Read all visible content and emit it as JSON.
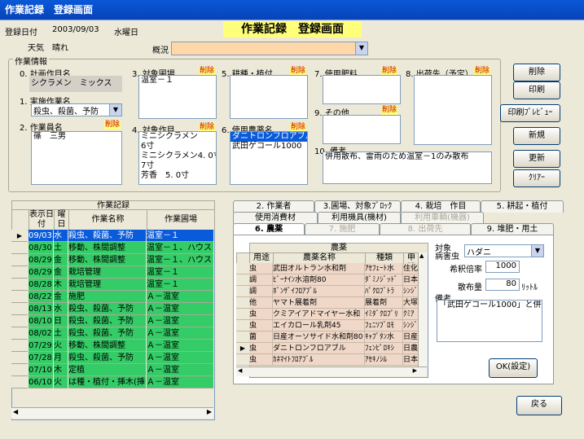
{
  "window_title": "作業記録　登録画面",
  "page_title": "作業記録　登録画面",
  "header": {
    "date_label": "登録日付",
    "date_value": "2003/09/03",
    "weekday": "水曜日",
    "weather_label": "天気",
    "weather_value": "晴れ",
    "condition_label": "概況",
    "condition_value": ""
  },
  "work_info": {
    "group_label": "作業情報",
    "plan_label": "0. 計画作目名",
    "plan_value": "シクラメン　ミックス",
    "method_label": "1. 実施作業名",
    "method_value": "殺虫、殺菌、予防",
    "worker_label": "2. 作業員名",
    "worker_value": "篠　三男",
    "field_label": "3. 対象圃場",
    "field_value": "温室－１",
    "crop_label": "4. 対象作目",
    "crop_lines": [
      "ミニシクラメン",
      "6寸",
      "ミニシクラメン4. 0寸",
      "7寸",
      "芳香　5. 0寸"
    ],
    "variety_label": "5. 耕種・植付",
    "pesticide_label": "6. 使用農薬名",
    "pesticide_lines": [
      "ダニトロンフロアブル",
      "武田ゲコール1000"
    ],
    "fertilizer_label": "7. 使用肥料",
    "other_label": "9. その他",
    "shipping_label": "8. 出荷先（予定）",
    "remarks_label": "10. 備考",
    "remarks_value": "併用散布、雷雨のため温室－1のみ散布",
    "delete_tag": "削除"
  },
  "buttons": {
    "delete": "削除",
    "print": "印刷",
    "preview": "印刷ﾌﾟﾚﾋﾞｭｰ",
    "new": "新規",
    "update": "更新",
    "clear": "ｸﾘｱｰ",
    "ok": "OK(設定)",
    "back": "戻る"
  },
  "records": {
    "title": "作業記録",
    "col_date": "表示日付",
    "col_weekday": "曜日",
    "col_name": "作業名称",
    "col_field": "作業圃場",
    "rows": [
      {
        "date": "09/03",
        "wd": "水",
        "name": "殺虫、殺菌、予防",
        "field": "温室－１"
      },
      {
        "date": "08/30",
        "wd": "土",
        "name": "移動、株間調整",
        "field": "温室－１、ハウス"
      },
      {
        "date": "08/29",
        "wd": "金",
        "name": "移動、株間調整",
        "field": "温室－１、ハウス"
      },
      {
        "date": "08/29",
        "wd": "金",
        "name": "栽培管理",
        "field": "温室－１"
      },
      {
        "date": "08/28",
        "wd": "木",
        "name": "栽培管理",
        "field": "温室－１"
      },
      {
        "date": "08/22",
        "wd": "金",
        "name": "施肥",
        "field": "Ａ－温室"
      },
      {
        "date": "08/13",
        "wd": "水",
        "name": "殺虫、殺菌、予防",
        "field": "Ａ－温室"
      },
      {
        "date": "08/10",
        "wd": "日",
        "name": "殺虫、殺菌、予防",
        "field": "Ａ－温室"
      },
      {
        "date": "08/02",
        "wd": "土",
        "name": "殺虫、殺菌、予防",
        "field": "Ａ－温室"
      },
      {
        "date": "07/29",
        "wd": "火",
        "name": "移動、株間調整",
        "field": "Ａ－温室"
      },
      {
        "date": "07/28",
        "wd": "月",
        "name": "殺虫、殺菌、予防",
        "field": "Ａ－温室"
      },
      {
        "date": "07/10",
        "wd": "木",
        "name": "定植",
        "field": "Ａ－温室"
      },
      {
        "date": "06/10",
        "wd": "火",
        "name": "は種・植付・挿木(挿",
        "field": "Ａ－温室"
      }
    ]
  },
  "tabs": {
    "row1": [
      "2. 作業者",
      "3.圃場、対象ﾌﾞﾛｯｸ",
      "4. 栽培　作目",
      "5. 耕起・植付"
    ],
    "row2": [
      "使用消費材",
      "利用機具(機材)",
      "利用車輌(機器)"
    ],
    "row3": [
      "6. 農薬",
      "7. 施肥",
      "8. 出荷先",
      "9. 堆肥・用土"
    ]
  },
  "pesticide_table": {
    "title": "農薬",
    "col_use": "用途",
    "col_name": "農薬名称",
    "col_type": "種類",
    "col_extra": "申請",
    "rows": [
      {
        "use": "虫",
        "name": "武田オルトラン水和剤",
        "type": "ｱｾﾌｪｰﾄ水",
        "extra": "住化"
      },
      {
        "use": "調",
        "name": "ﾋﾞｰﾅｲﾝ水溶剤80",
        "type": "ﾀﾞﾐﾉｼﾞｯﾄﾞ",
        "extra": "日本"
      },
      {
        "use": "調",
        "name": "ﾎﾞﾝｻﾞｲﾌﾛｱﾌﾞﾙ",
        "type": "ﾊﾟｸﾛﾌﾞﾄﾗ",
        "extra": "ｼﾝｼﾞ"
      },
      {
        "use": "他",
        "name": "ヤマト展着剤",
        "type": "展着剤",
        "extra": "大塚"
      },
      {
        "use": "虫",
        "name": "クミアイアドマイヤー水和",
        "type": "ｲﾐﾀﾞｸﾛﾌﾟﾘ",
        "extra": "ｸﾐｱ"
      },
      {
        "use": "虫",
        "name": "エイカロール乳剤45",
        "type": "ﾌｪﾆｿﾌﾞﾛﾓ",
        "extra": "ｼﾝｼﾞ"
      },
      {
        "use": "菌",
        "name": "日産オーソサイド水和剤80",
        "type": "ｷｬﾌﾟﾀﾝ水",
        "extra": "日産"
      },
      {
        "use": "虫",
        "name": "ダニトロンフロアブル",
        "type": "ﾌｪﾝﾋﾟﾛｷｼ",
        "extra": "日農"
      },
      {
        "use": "虫",
        "name": "ｶﾈﾏｲﾄﾌﾛｱﾌﾞﾙ",
        "type": "ｱｾｷﾉｼﾙ",
        "extra": "日本"
      }
    ]
  },
  "detail": {
    "target_label": "対象",
    "pest_label": "病害虫",
    "pest_value": "ハダニ",
    "dilution_label": "希釈倍率",
    "dilution_value": "1000",
    "amount_label": "散布量",
    "amount_value": "80",
    "amount_unit": "ﾘｯﾄﾙ",
    "remarks_label": "備考",
    "remarks_value": "「武田ゲコール1000」と併用"
  },
  "colors": {
    "selected_row": "#0a5bdb",
    "green_row": "#33cc66",
    "highlight": "#ffff7a",
    "combo_bg": "#ffd7a8"
  }
}
